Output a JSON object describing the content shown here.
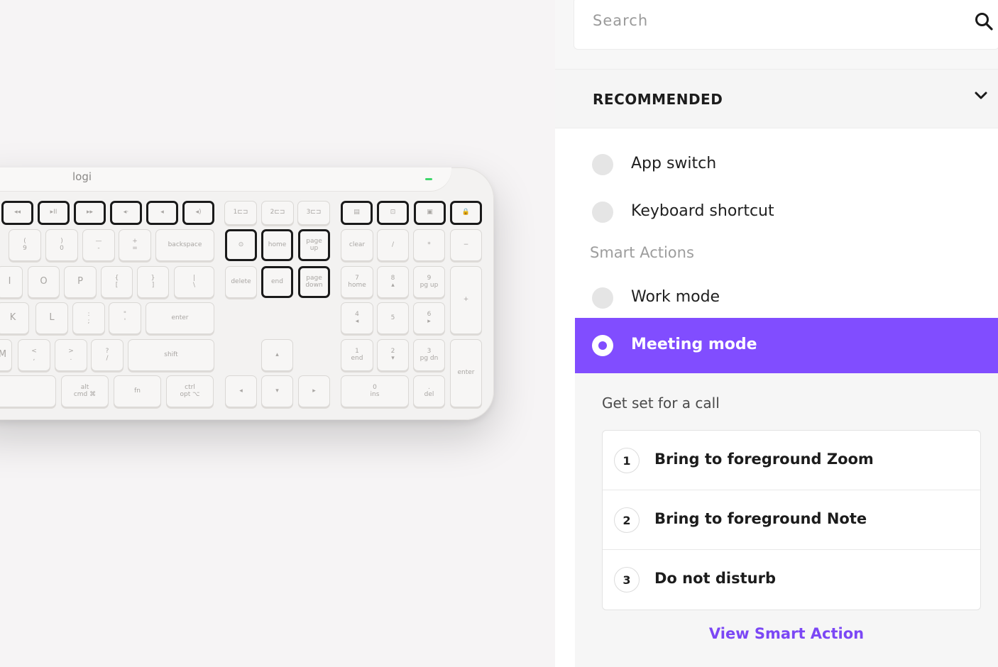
{
  "keyboard": {
    "brand": "logi",
    "fn_row": [
      "◂◂",
      "▸II",
      "▸▸",
      "◂·",
      "◂",
      "◂)",
      "1⊏⊐",
      "2⊏⊐",
      "3⊏⊐",
      "▤",
      "⊡",
      "▣",
      "🔒"
    ],
    "row_num": [
      "(\n9",
      ")\n0",
      "—\n-",
      "+\n=",
      "backspace",
      "⊙",
      "home",
      "page\nup",
      "clear",
      "/",
      "*",
      "−"
    ],
    "row_top": [
      "I",
      "O",
      "P",
      "{\n[",
      "}\n]",
      "|\n\\",
      "delete",
      "end",
      "page\ndown",
      "7\nhome",
      "8\n▴",
      "9\npg up",
      "+"
    ],
    "row_home": [
      "K",
      "L",
      ":\n;",
      "\"\n'",
      "enter",
      "4\n◂",
      "5",
      "6\n▸"
    ],
    "row_bottom": [
      "M",
      "<\n,",
      ">\n.",
      "?\n/",
      "shift",
      "▴",
      "1\nend",
      "2\n▾",
      "3\npg dn",
      "enter"
    ],
    "row_space": [
      "alt\ncmd ⌘",
      "fn",
      "ctrl\nopt ⌥",
      "◂",
      "▾",
      "▸",
      "0\nins",
      ".\ndel",
      "="
    ]
  },
  "search": {
    "placeholder": "Search"
  },
  "recommended": {
    "title": "RECOMMENDED"
  },
  "options": {
    "app_switch": "App switch",
    "keyboard_shortcut": "Keyboard shortcut",
    "smart_actions_section": "Smart Actions",
    "work_mode": "Work mode",
    "meeting_mode": "Meeting mode"
  },
  "detail": {
    "description": "Get set for a call",
    "steps": [
      {
        "num": "1",
        "label": "Bring to foreground Zoom"
      },
      {
        "num": "2",
        "label": "Bring to foreground Note"
      },
      {
        "num": "3",
        "label": "Do not disturb"
      }
    ],
    "view_link": "View Smart Action"
  },
  "colors": {
    "accent": "#814dff",
    "link": "#7b47f5",
    "led": "#3fd66b"
  }
}
